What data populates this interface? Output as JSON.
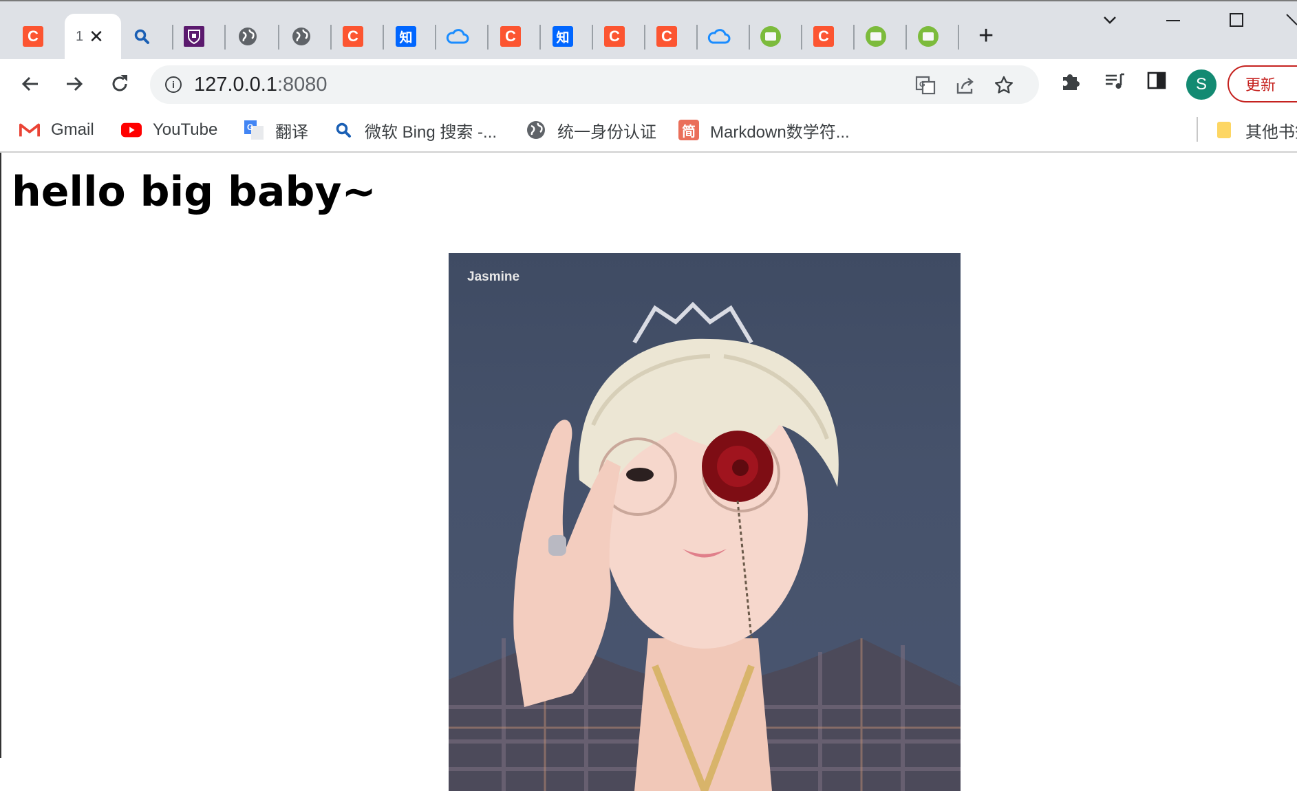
{
  "tabs": {
    "active_title": "1",
    "items": [
      {
        "icon": "csdn-icon"
      },
      {
        "icon": "active-tab",
        "title": "1"
      },
      {
        "icon": "search-icon"
      },
      {
        "icon": "university-shield-icon"
      },
      {
        "icon": "globe-icon"
      },
      {
        "icon": "globe-icon"
      },
      {
        "icon": "csdn-icon"
      },
      {
        "icon": "zhihu-icon",
        "glyph": "知"
      },
      {
        "icon": "cloud-icon"
      },
      {
        "icon": "csdn-icon"
      },
      {
        "icon": "zhihu-icon",
        "glyph": "知"
      },
      {
        "icon": "csdn-icon"
      },
      {
        "icon": "csdn-icon"
      },
      {
        "icon": "cloud-icon"
      },
      {
        "icon": "code-icon"
      },
      {
        "icon": "csdn-icon"
      },
      {
        "icon": "code-icon"
      },
      {
        "icon": "code-icon"
      }
    ],
    "csdn_glyph": "C",
    "zhihu_glyph": "知",
    "close_glyph": "✕",
    "new_tab_glyph": "+"
  },
  "window_controls": {
    "dropdown": "⌵",
    "minimize": "—",
    "maximize": "☐",
    "close": "✕"
  },
  "toolbar": {
    "url_host": "127.0.0.1",
    "url_port": ":8080",
    "info_glyph": "i",
    "avatar_letter": "S",
    "update_label": "更新"
  },
  "bookmarks": [
    {
      "label": "Gmail",
      "icon": "gmail-icon"
    },
    {
      "label": "YouTube",
      "icon": "youtube-icon"
    },
    {
      "label": "翻译",
      "icon": "google-translate-icon"
    },
    {
      "label": "微软 Bing 搜索 -...",
      "icon": "bing-search-icon"
    },
    {
      "label": "统一身份认证",
      "icon": "globe-icon"
    },
    {
      "label": "Markdown数学符...",
      "icon": "jianshu-icon",
      "glyph": "简"
    },
    {
      "label": "其他书签",
      "icon": "folder-icon"
    }
  ],
  "page": {
    "heading": "hello big baby~",
    "photo_caption": "Jasmine"
  },
  "colors": {
    "tab_strip": "#dee1e6",
    "csdn": "#fc5531",
    "zhihu": "#0066ff",
    "update_red": "#c5221f",
    "avatar": "#138a72",
    "photo_bg": "#46526b"
  }
}
